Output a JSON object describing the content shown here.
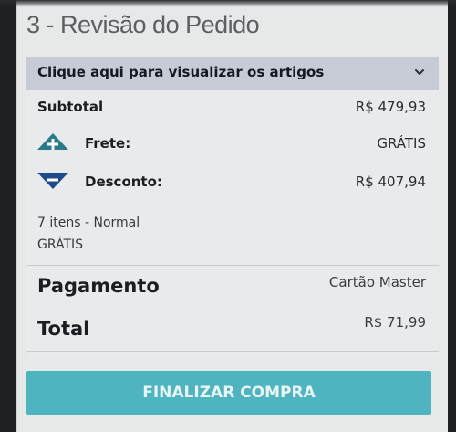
{
  "section": {
    "title": "3 - Revisão do Pedido"
  },
  "items_toggle": {
    "label": "Clique aqui para visualizar os artigos",
    "icon": "chevron-down-icon"
  },
  "summary": {
    "subtotal_label": "Subtotal",
    "subtotal_value": "R$ 479,93",
    "shipping_label": "Frete:",
    "shipping_value": "GRÁTIS",
    "shipping_icon": "plus-triangle-icon",
    "discount_label": "Desconto:",
    "discount_value": "R$ 407,94",
    "discount_icon": "minus-triangle-icon",
    "shipping_method": "7 itens - Normal",
    "shipping_method_cost": "GRÁTIS"
  },
  "payment": {
    "label": "Pagamento",
    "value": "Cartão Master"
  },
  "total": {
    "label": "Total",
    "value": "R$ 71,99"
  },
  "actions": {
    "checkout_label": "FINALIZAR COMPRA"
  },
  "colors": {
    "accent_button": "#4eb4bf",
    "toggle_bar": "#c6cbd6",
    "icon_blue": "#1f4b8c",
    "icon_teal": "#2a7b8a"
  }
}
